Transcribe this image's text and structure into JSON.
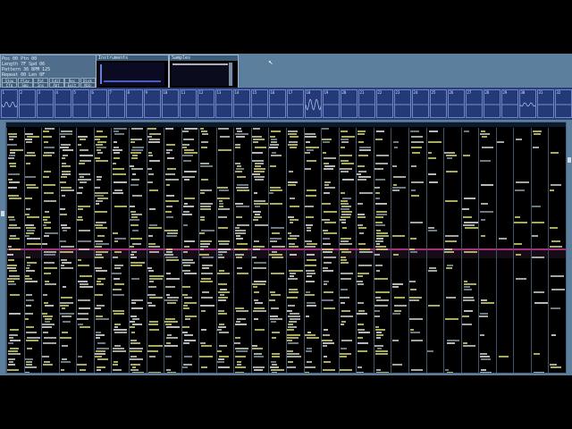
{
  "app": {
    "position_panel": {
      "rows": [
        "Pos 00  Ptn 00  ",
        "Length 7F  Spd 06",
        "Pattern 36  BPM 125",
        "Repeat 00  Len 0F"
      ],
      "buttons": [
        "Stop",
        "Play",
        "Pat",
        "Edit",
        "Rec",
        "Disk",
        "Cfg",
        "Smp",
        "Ins",
        "Abt",
        "Exit",
        "Nib"
      ]
    },
    "instruments_panel": {
      "title": "Instruments"
    },
    "samples_panel": {
      "title": "Samples"
    },
    "colors": {
      "bg": "#5c7f9e",
      "pattern_bg": "#000000",
      "cursor_row": "#b8338c",
      "scope_bg": "#243a78"
    },
    "scope_numbers": [
      "1",
      "2",
      "3",
      "4",
      "5",
      "6",
      "7",
      "8",
      "9",
      "10",
      "11",
      "12",
      "13",
      "14",
      "15",
      "16",
      "17",
      "18",
      "19",
      "20",
      "21",
      "22",
      "23",
      "24",
      "25",
      "26",
      "27",
      "28",
      "29",
      "30",
      "31",
      "32"
    ]
  }
}
